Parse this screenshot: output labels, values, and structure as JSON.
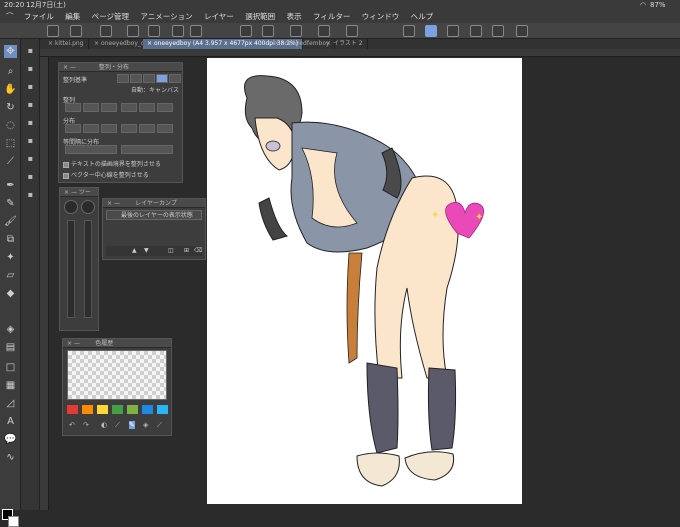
{
  "status": {
    "time": "20:20",
    "date": "12月7日(土)",
    "battery": "87%"
  },
  "menu": [
    "ファイル",
    "編集",
    "ページ管理",
    "アニメーション",
    "レイヤー",
    "選択範囲",
    "表示",
    "フィルター",
    "ウィンドウ",
    "ヘルプ"
  ],
  "tabs": [
    "kittei.png",
    "oneeyedboy_co",
    "oneeyedboy (A4 3.957 x 4677px 400dpi 38.2%)",
    "oneeyedfemboy",
    "イラスト 2"
  ],
  "align_panel": {
    "title": "整列・分布",
    "align_basis": "整列基準",
    "auto": "自動：キャンバス",
    "align": "整列",
    "distribute": "分布",
    "equal_distribute": "等間隔に分布",
    "check1": "テキストの描画境界を整列させる",
    "check2": "ベクター中心線を整列させる"
  },
  "brush_panel": {
    "title": "ツー"
  },
  "layer_panel": {
    "title": "レイヤーカンプ",
    "item": "最後のレイヤーの表示状態"
  },
  "color_panel": {
    "title": "色履歴",
    "swatches": [
      "#e53935",
      "#fb8c00",
      "#fdd835",
      "#43a047",
      "#7cb342",
      "#1e88e5",
      "#29b6f6"
    ]
  },
  "icons": {
    "tools": [
      "move-icon",
      "zoom-icon",
      "hand-icon",
      "rotate-icon",
      "lasso-icon",
      "eyedropper-icon",
      "pen-icon",
      "pencil-icon",
      "brush-icon",
      "airbrush-icon",
      "eraser-icon",
      "fill-icon",
      "gradient-icon",
      "shape-icon",
      "frame-icon",
      "ruler-icon",
      "text-icon",
      "balloon-icon",
      "correct-line-icon"
    ]
  }
}
